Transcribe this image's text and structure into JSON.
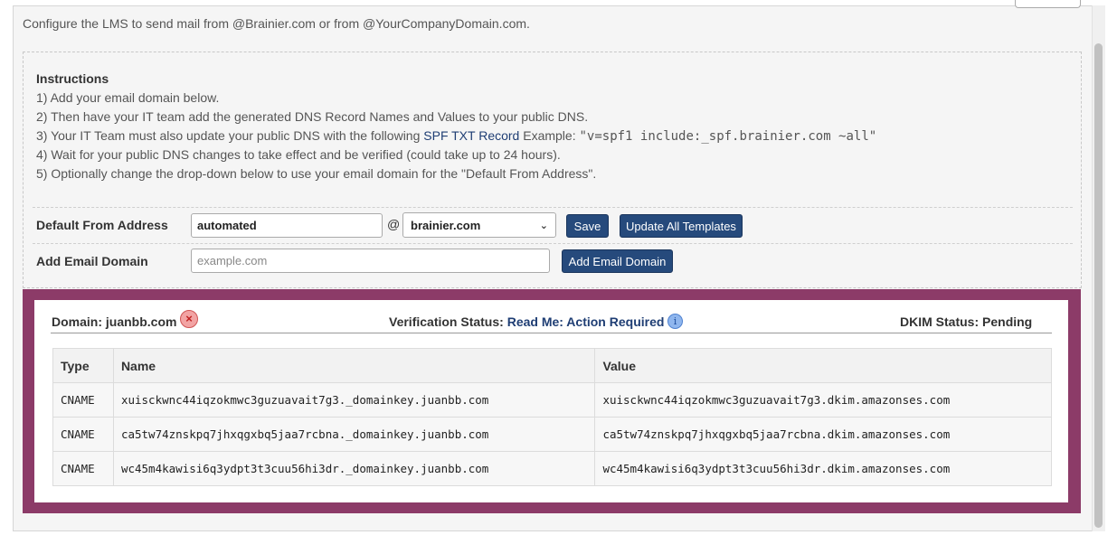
{
  "intro_text": "Configure the LMS to send mail from @Brainier.com or from @YourCompanyDomain.com.",
  "instructions": {
    "title": "Instructions",
    "step1": "1) Add your email domain below.",
    "step2": "2) Then have your IT team add the generated DNS Record Names and Values to your public DNS.",
    "step3_prefix": "3) Your IT Team must also update your public DNS with the following ",
    "step3_link": "SPF TXT Record",
    "step3_example_label": " Example: ",
    "step3_example_code": "\"v=spf1 include:_spf.brainier.com ~all\"",
    "step4": "4) Wait for your public DNS changes to take effect and be verified (could take up to 24 hours).",
    "step5": "5) Optionally change the drop-down below to use your email domain for the \"Default From Address\"."
  },
  "default_from": {
    "label": "Default From Address",
    "value": "automated",
    "at": "@",
    "domain_selected": "brainier.com",
    "save_label": "Save",
    "update_templates_label": "Update All Templates"
  },
  "add_domain": {
    "label": "Add Email Domain",
    "placeholder": "example.com",
    "button_label": "Add Email Domain"
  },
  "domain_card": {
    "domain_label": "Domain:",
    "domain_value": "juanbb.com",
    "remove_glyph": "×",
    "verification_label": "Verification Status:",
    "verification_value": "Read Me: Action Required",
    "info_glyph": "i",
    "dkim_label": "DKIM Status:",
    "dkim_value": "Pending",
    "table": {
      "headers": [
        "Type",
        "Name",
        "Value"
      ],
      "rows": [
        [
          "CNAME",
          "xuisckwnc44iqzokmwc3guzuavait7g3._domainkey.juanbb.com",
          "xuisckwnc44iqzokmwc3guzuavait7g3.dkim.amazonses.com"
        ],
        [
          "CNAME",
          "ca5tw74znskpq7jhxqgxbq5jaa7rcbna._domainkey.juanbb.com",
          "ca5tw74znskpq7jhxqgxbq5jaa7rcbna.dkim.amazonses.com"
        ],
        [
          "CNAME",
          "wc45m4kawisi6q3ydpt3t3cuu56hi3dr._domainkey.juanbb.com",
          "wc45m4kawisi6q3ydpt3t3cuu56hi3dr.dkim.amazonses.com"
        ]
      ]
    }
  },
  "colors": {
    "primary_button": "#264a7c",
    "domain_frame": "#8c3b68",
    "link": "#1f3e74"
  },
  "icons": {
    "remove": "remove-circle-icon",
    "info": "info-circle-icon",
    "dropdown": "chevron-down-icon"
  }
}
